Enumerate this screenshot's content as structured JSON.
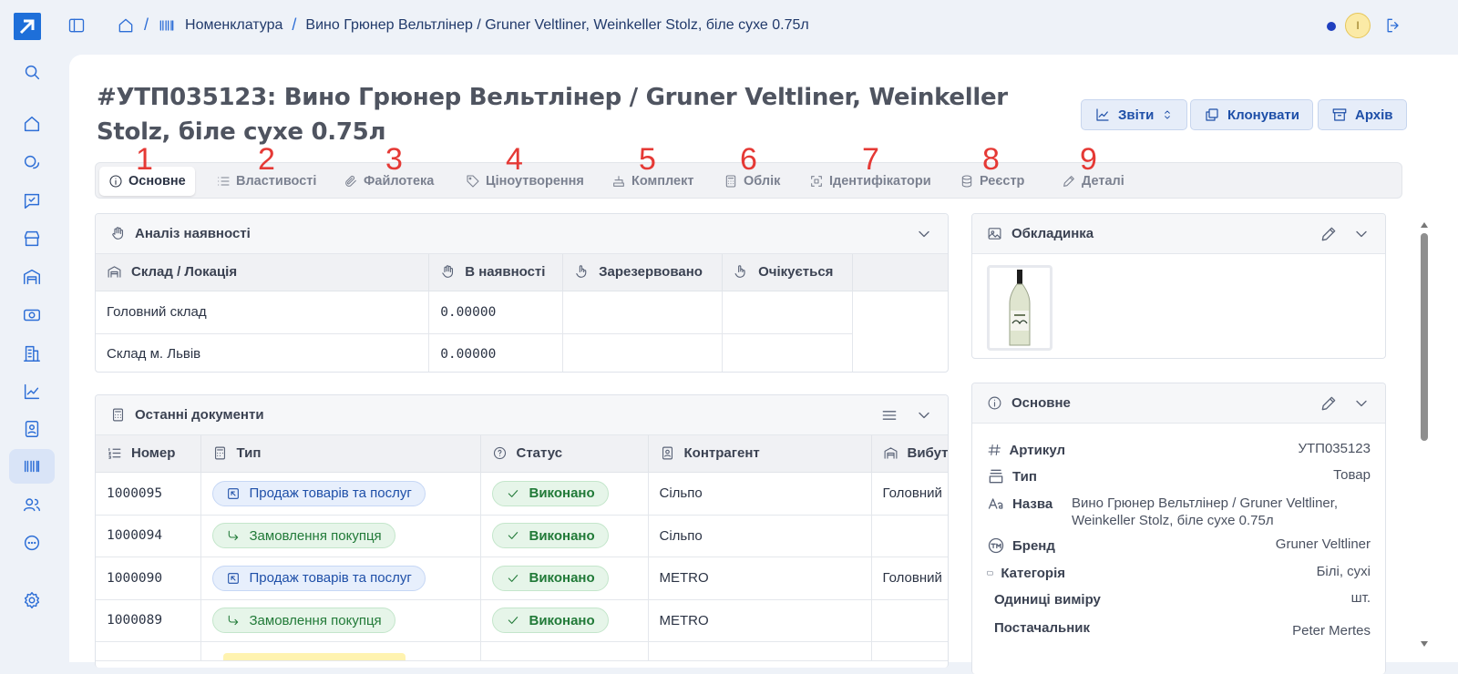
{
  "breadcrumb": {
    "items": [
      "Номенклатура",
      "Вино Грюнер Вельтлінер / Gruner Veltliner, Weinkeller Stolz, біле сухе 0.75л"
    ],
    "separator": "/"
  },
  "user": {
    "avatar_initial": "I",
    "status_color": "#1f3fbf"
  },
  "page": {
    "title": "#УТП035123: Вино Грюнер Вельтлінер / Gruner Veltliner, Weinkeller Stolz, біле сухе 0.75л",
    "buttons": {
      "reports": "Звіти",
      "clone": "Клонувати",
      "archive": "Архів"
    }
  },
  "tabs": [
    {
      "label": "Основне",
      "marker": "1"
    },
    {
      "label": "Властивості",
      "marker": "2"
    },
    {
      "label": "Файлотека",
      "marker": "3"
    },
    {
      "label": "Ціноутворення",
      "marker": "4"
    },
    {
      "label": "Комплект",
      "marker": "5"
    },
    {
      "label": "Облік",
      "marker": "6"
    },
    {
      "label": "Ідентифікатори",
      "marker": "7"
    },
    {
      "label": "Реєстр",
      "marker": "8"
    },
    {
      "label": "Деталі",
      "marker": "9"
    }
  ],
  "availability": {
    "title": "Аналіз наявності",
    "columns": [
      "Склад / Локація",
      "В наявності",
      "Зарезервовано",
      "Очікується"
    ],
    "rows": [
      {
        "location": "Головний склад",
        "in_stock": "0.00000",
        "reserved": "",
        "expected": ""
      },
      {
        "location": "Склад м. Львів",
        "in_stock": "0.00000",
        "reserved": "",
        "expected": ""
      }
    ]
  },
  "documents": {
    "title": "Останні документи",
    "columns": [
      "Номер",
      "Тип",
      "Статус",
      "Контрагент",
      "Вибут"
    ],
    "rows": [
      {
        "number": "1000095",
        "type": "Продаж товарів та послуг",
        "type_style": "blue",
        "status": "Виконано",
        "counterparty": "Сільпо",
        "from": "Головний"
      },
      {
        "number": "1000094",
        "type": "Замовлення покупця",
        "type_style": "green",
        "status": "Виконано",
        "counterparty": "Сільпо",
        "from": ""
      },
      {
        "number": "1000090",
        "type": "Продаж товарів та послуг",
        "type_style": "blue",
        "status": "Виконано",
        "counterparty": "METRO",
        "from": "Головний"
      },
      {
        "number": "1000089",
        "type": "Замовлення покупця",
        "type_style": "green",
        "status": "Виконано",
        "counterparty": "METRO",
        "from": ""
      }
    ]
  },
  "cover": {
    "title": "Обкладинка"
  },
  "details": {
    "title": "Основне",
    "fields": [
      {
        "label": "Артикул",
        "value": "УТП035123",
        "icon": "hash-icon"
      },
      {
        "label": "Тип",
        "value": "Товар",
        "icon": "type-icon"
      },
      {
        "label": "Назва",
        "value": "Вино Грюнер Вельтлінер / Gruner Veltliner, Weinkeller Stolz, біле сухе 0.75л",
        "icon": "text-aa-icon"
      },
      {
        "label": "Бренд",
        "value": "Gruner Veltliner",
        "icon": "trademark-icon"
      },
      {
        "label": "Категорія",
        "value": "Білі, сухі",
        "icon": "folder-icon"
      },
      {
        "label": "Одиниці виміру",
        "value": "шт.",
        "icon": "ruler-icon"
      },
      {
        "label": "Постачальник",
        "value": "Peter Mertes",
        "icon": "contact-icon"
      }
    ]
  },
  "colors": {
    "accent": "#2d6ed6",
    "marker": "#e53935",
    "success": "#217a38"
  }
}
